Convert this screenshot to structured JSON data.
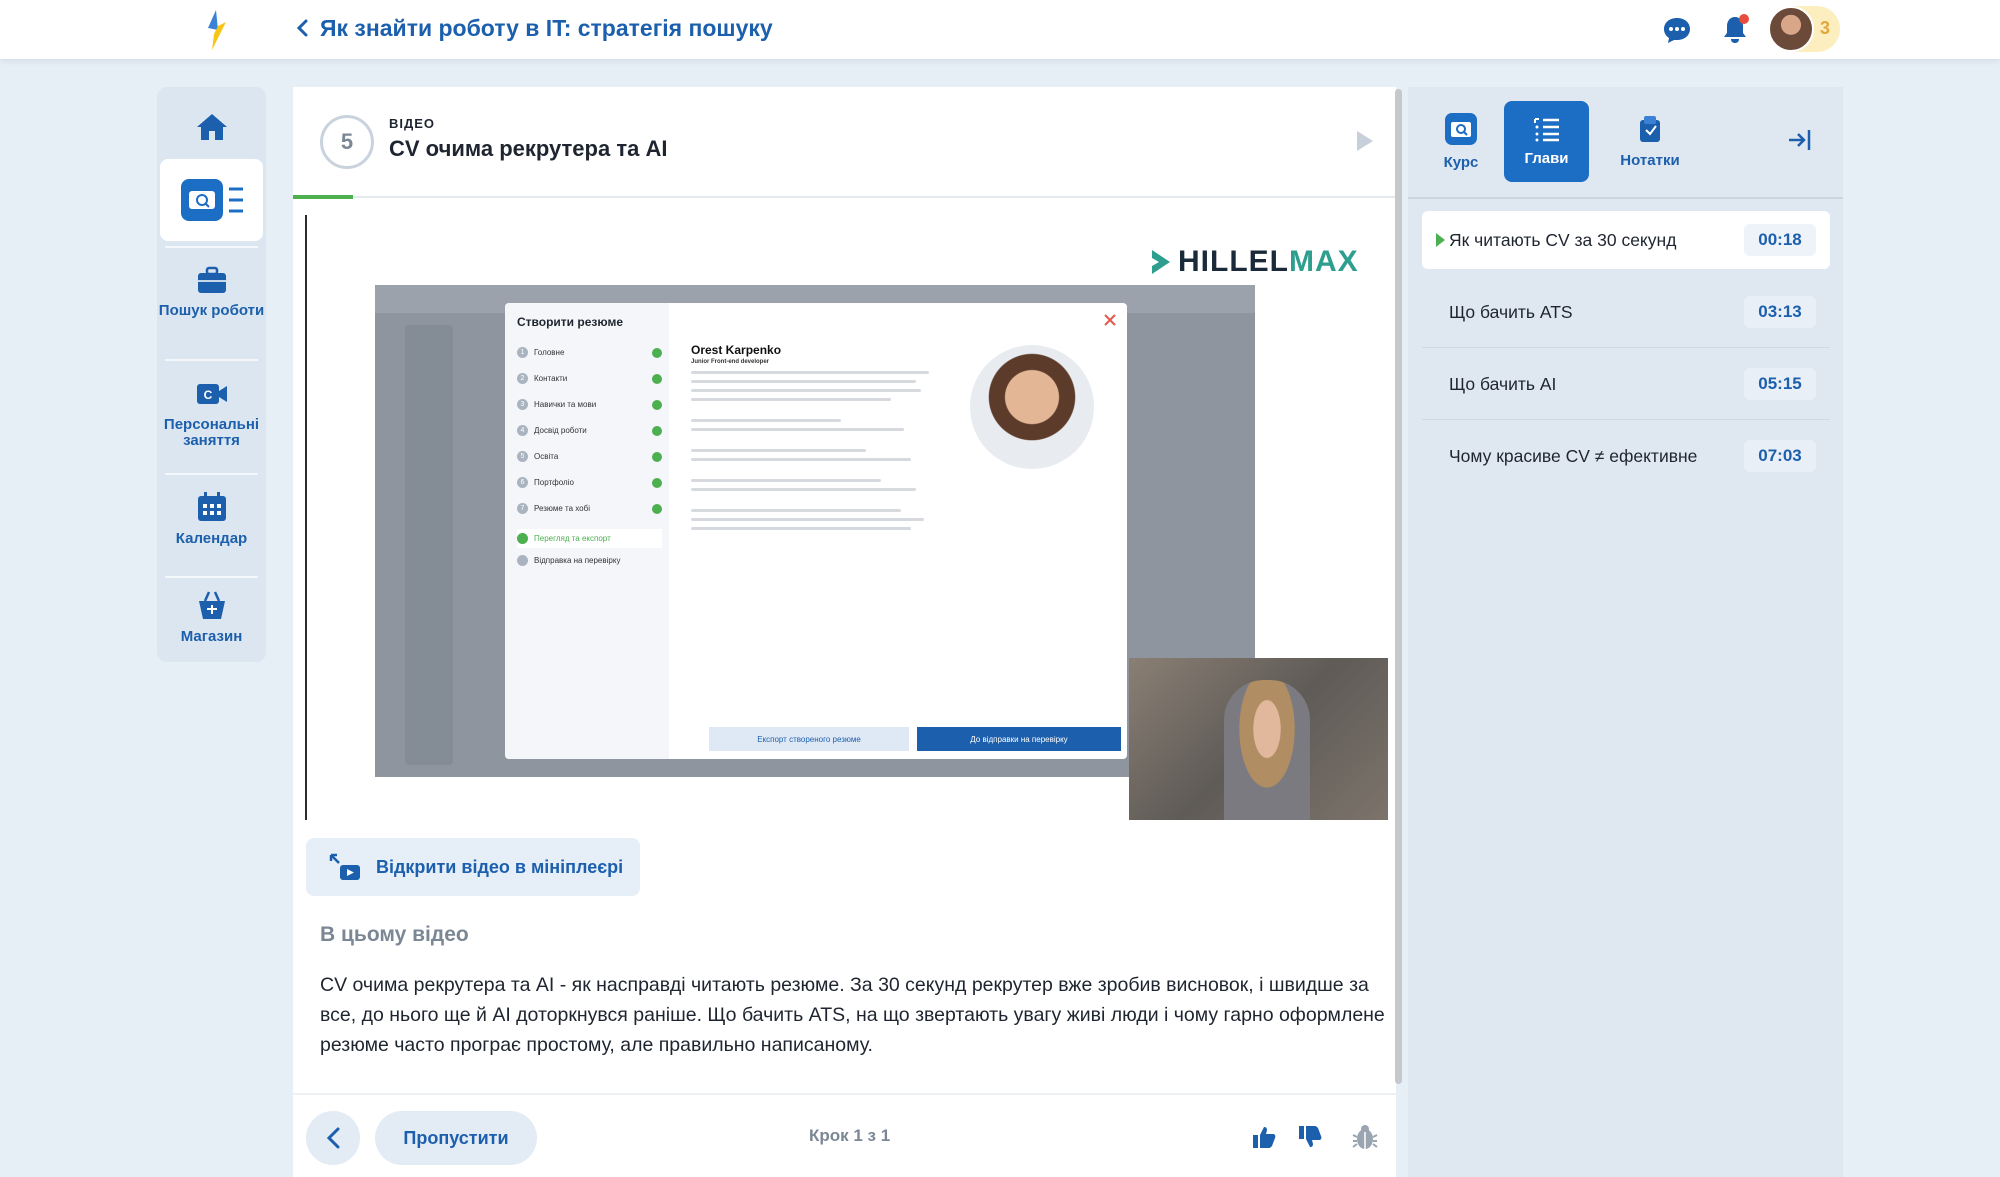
{
  "header": {
    "back_label": "Як знайти роботу в IT: стратегія пошуку",
    "notifications_badge": "3"
  },
  "sidebar": {
    "items": [
      {
        "label": "",
        "icon": "home-icon"
      },
      {
        "label": "",
        "icon": "course-list-icon"
      },
      {
        "label": "Пошук роботи",
        "icon": "briefcase-icon"
      },
      {
        "label": "Персональні заняття",
        "icon": "video-call-icon"
      },
      {
        "label": "Календар",
        "icon": "calendar-icon"
      },
      {
        "label": "Магазин",
        "icon": "shop-basket-icon"
      }
    ]
  },
  "lesson": {
    "number": "5",
    "kind": "ВІДЕО",
    "title": "CV очима рекрутера та AI"
  },
  "video": {
    "brand_a": "HILLEL",
    "brand_b": "MAX",
    "modal_title": "Створити резюме",
    "steps": [
      "Головне",
      "Контакти",
      "Навички та мови",
      "Досвід роботи",
      "Освіта",
      "Портфоліо",
      "Резюме та хобі",
      "Перегляд та експорт",
      "Відправка на перевірку"
    ],
    "resume_name": "Orest Karpenko",
    "resume_role": "Junior Front-end developer",
    "export_btn": "Експорт створеного резюме",
    "submit_btn": "До відправки на перевірку"
  },
  "mini_player_label": "Відкрити відео в мініплеєрі",
  "description": {
    "heading": "В цьому відео",
    "text": "CV очима рекрутера та AI - як насправді читають резюме. За 30 секунд рекрутер вже зробив висновок, і швидше за все, до нього ще й AI доторкнувся раніше. Що бачить ATS, на що звертають увагу живі люди і чому гарно оформлене резюме часто програє простому, але правильно написаному."
  },
  "footer": {
    "skip_label": "Пропустити",
    "step_counter": "Крок 1 з 1"
  },
  "right_panel": {
    "tabs": [
      {
        "label": "Курс",
        "icon": "course-icon"
      },
      {
        "label": "Глави",
        "icon": "chapters-icon"
      },
      {
        "label": "Нотатки",
        "icon": "notes-icon"
      }
    ],
    "chapters": [
      {
        "title": "Як читають CV за 30 секунд",
        "time": "00:18"
      },
      {
        "title": "Що бачить ATS",
        "time": "03:13"
      },
      {
        "title": "Що бачить AI",
        "time": "05:15"
      },
      {
        "title": "Чому красиве CV ≠ ефективне",
        "time": "07:03"
      }
    ]
  },
  "colors": {
    "accent": "#1c5fad",
    "active_tab": "#1c6dc4",
    "progress": "#4caf50",
    "page_bg": "#e6eef6"
  }
}
